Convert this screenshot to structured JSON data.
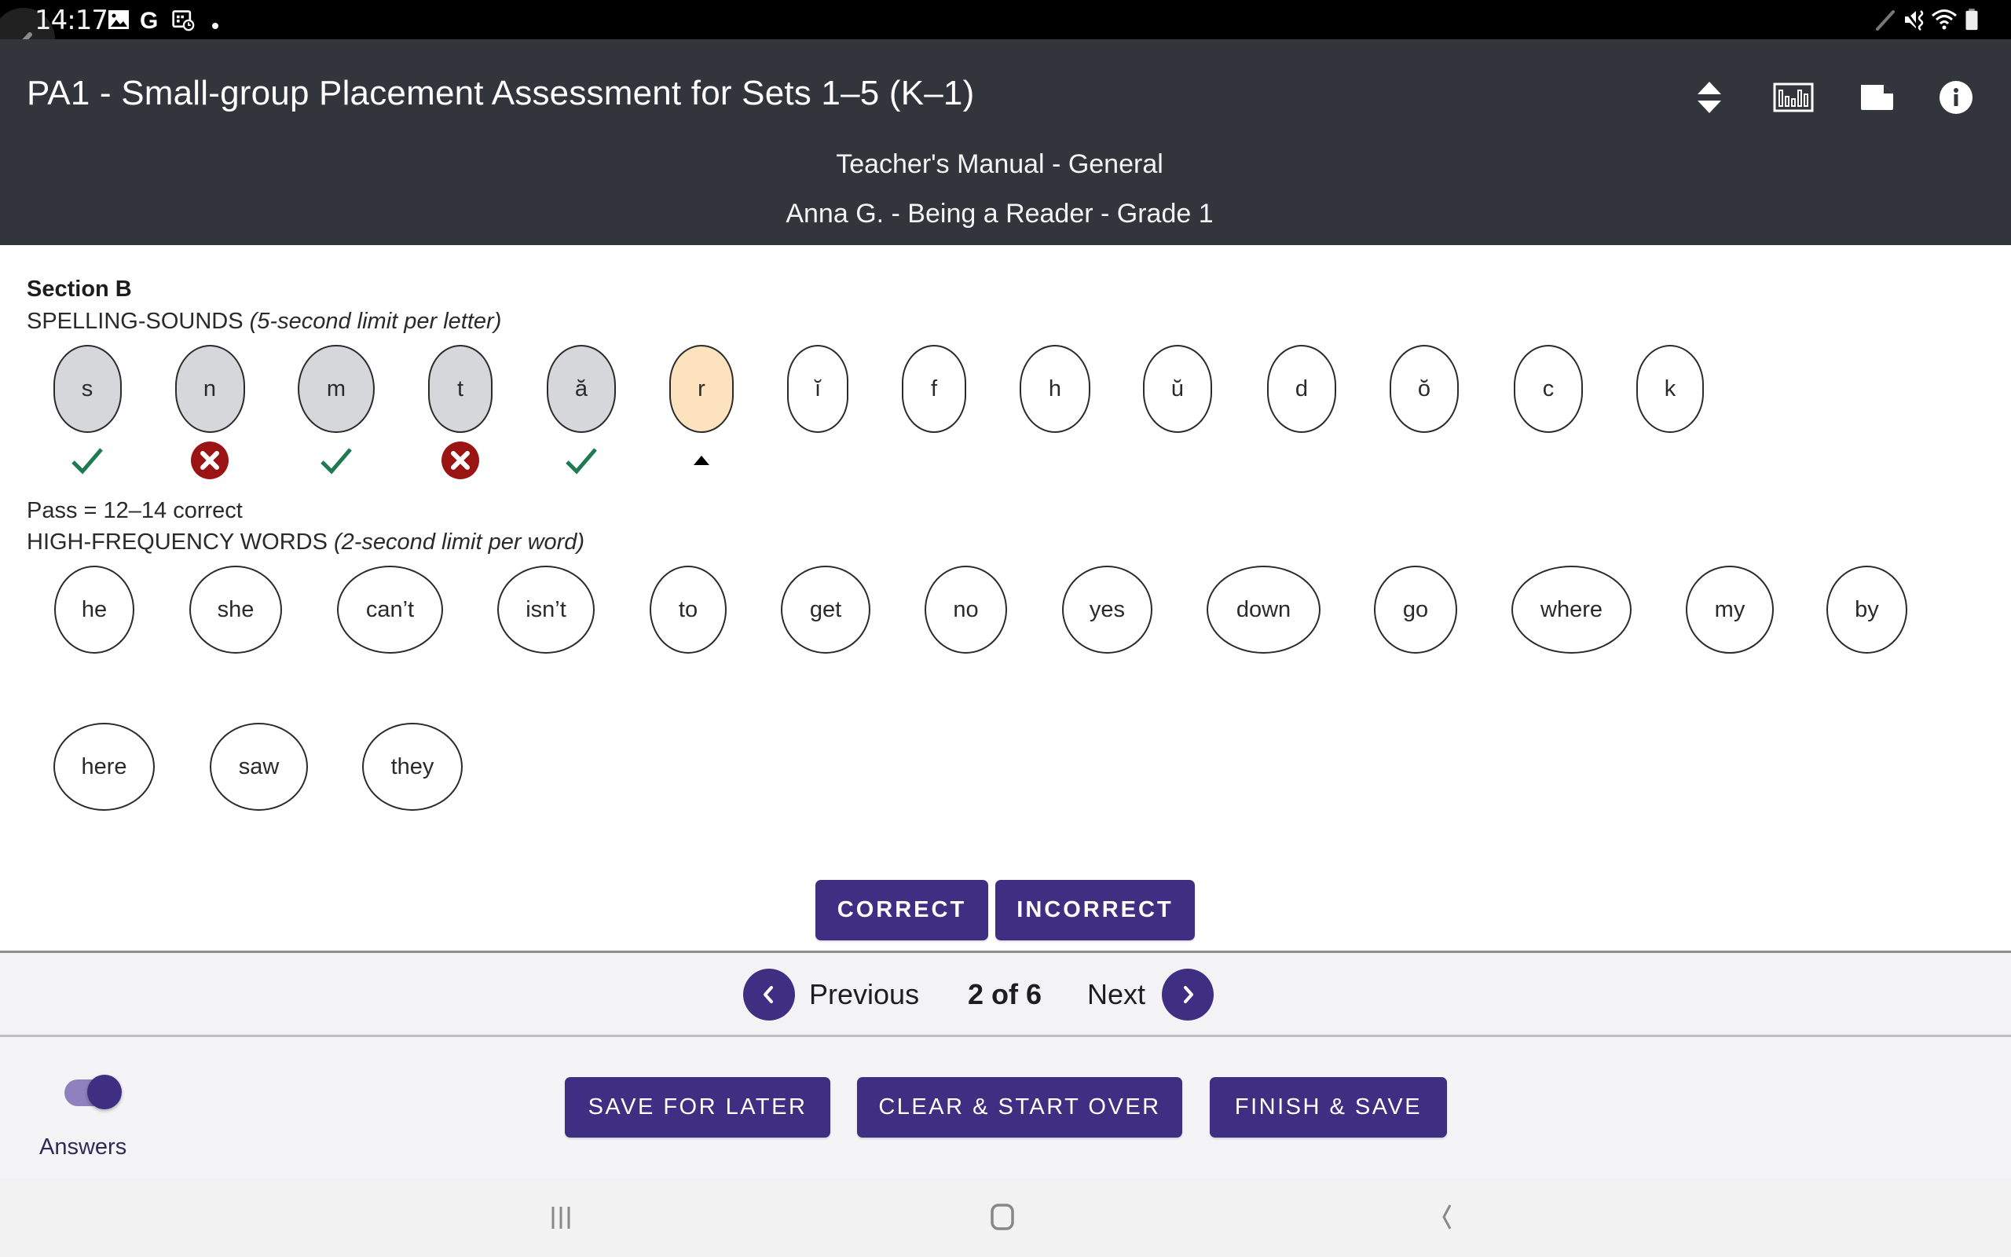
{
  "status_bar": {
    "time": "14:17",
    "left_icons": [
      "gallery-icon",
      "google-icon",
      "calendar-clock-icon",
      "notification-dot-icon"
    ],
    "right_icons": [
      "pen-icon",
      "mute-vibrate-icon",
      "wifi-icon",
      "battery-icon"
    ]
  },
  "header": {
    "title": "PA1 - Small-group Placement Assessment for Sets 1–5 (K–1)",
    "subtitle_manual": "Teacher's Manual - General",
    "subtitle_student": "Anna  G. - Being a Reader - Grade 1",
    "actions": [
      {
        "name": "expand-collapse",
        "icon": "sort-arrows-icon"
      },
      {
        "name": "report",
        "icon": "bar-chart-icon"
      },
      {
        "name": "notes",
        "icon": "note-icon"
      },
      {
        "name": "info",
        "icon": "info-icon"
      }
    ]
  },
  "section": {
    "title": "Section B",
    "spelling_label": "SPELLING-SOUNDS ",
    "spelling_hint": "(5-second limit per letter)",
    "letters": [
      {
        "text": "s",
        "state": "done",
        "result": "correct"
      },
      {
        "text": "n",
        "state": "done",
        "result": "incorrect"
      },
      {
        "text": "m",
        "state": "done",
        "result": "correct"
      },
      {
        "text": "t",
        "state": "done",
        "result": "incorrect"
      },
      {
        "text": "ă",
        "state": "done",
        "result": "correct"
      },
      {
        "text": "r",
        "state": "current",
        "result": "current"
      },
      {
        "text": "ĭ",
        "state": "pending",
        "result": ""
      },
      {
        "text": "f",
        "state": "pending",
        "result": ""
      },
      {
        "text": "h",
        "state": "pending",
        "result": ""
      },
      {
        "text": "ŭ",
        "state": "pending",
        "result": ""
      },
      {
        "text": "d",
        "state": "pending",
        "result": ""
      },
      {
        "text": "ŏ",
        "state": "pending",
        "result": ""
      },
      {
        "text": "c",
        "state": "pending",
        "result": ""
      },
      {
        "text": "k",
        "state": "pending",
        "result": ""
      }
    ],
    "pass_text": "Pass = 12–14 correct",
    "hf_label": "HIGH-FREQUENCY WORDS ",
    "hf_hint": "(2-second limit per word)",
    "words_row1": [
      "he",
      "she",
      "can’t",
      "isn’t",
      "to",
      "get",
      "no",
      "yes",
      "down",
      "go",
      "where",
      "my",
      "by"
    ],
    "words_row2": [
      "here",
      "saw",
      "they"
    ]
  },
  "scoring": {
    "correct_label": "CORRECT",
    "incorrect_label": "INCORRECT"
  },
  "pager": {
    "previous_label": "Previous",
    "page_indicator": "2 of 6",
    "next_label": "Next"
  },
  "footer": {
    "answers_toggle_label": "Answers",
    "answers_toggle_on": true,
    "save_later_label": "SAVE FOR LATER",
    "clear_label": "CLEAR & START OVER",
    "finish_label": "FINISH & SAVE"
  },
  "colors": {
    "brand_purple": "#3f2f82",
    "header_bg": "#32353c",
    "correct_green": "#1e7a4f",
    "incorrect_red": "#9b1414",
    "current_item": "#fde3bd",
    "done_item": "#d6d7db"
  }
}
